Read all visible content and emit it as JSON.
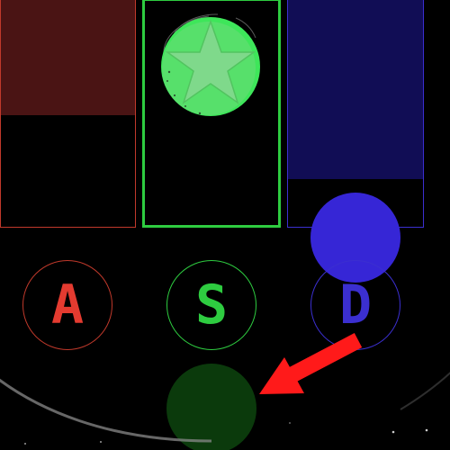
{
  "lanes": [
    {
      "id": "a",
      "color": "#c0392b",
      "fill_color": "#4a1414",
      "fill_level": 0.51
    },
    {
      "id": "s",
      "color": "#2ecc40",
      "fill_color": "#000000",
      "fill_level": 0,
      "active": true
    },
    {
      "id": "d",
      "color": "#3b2fd0",
      "fill_color": "#110d55",
      "fill_level": 0.79
    }
  ],
  "keys": {
    "a": "A",
    "s": "S",
    "d": "D"
  },
  "notes": [
    {
      "lane": "d",
      "color": "#3626d6"
    },
    {
      "lane": "s",
      "color": "#0b3a0c"
    }
  ],
  "star_token": {
    "icon": "star-icon",
    "color": "#2ee04a"
  },
  "hint_arrow": {
    "icon": "arrow-down-left-icon",
    "color": "#ff1a1a",
    "target": "s"
  }
}
